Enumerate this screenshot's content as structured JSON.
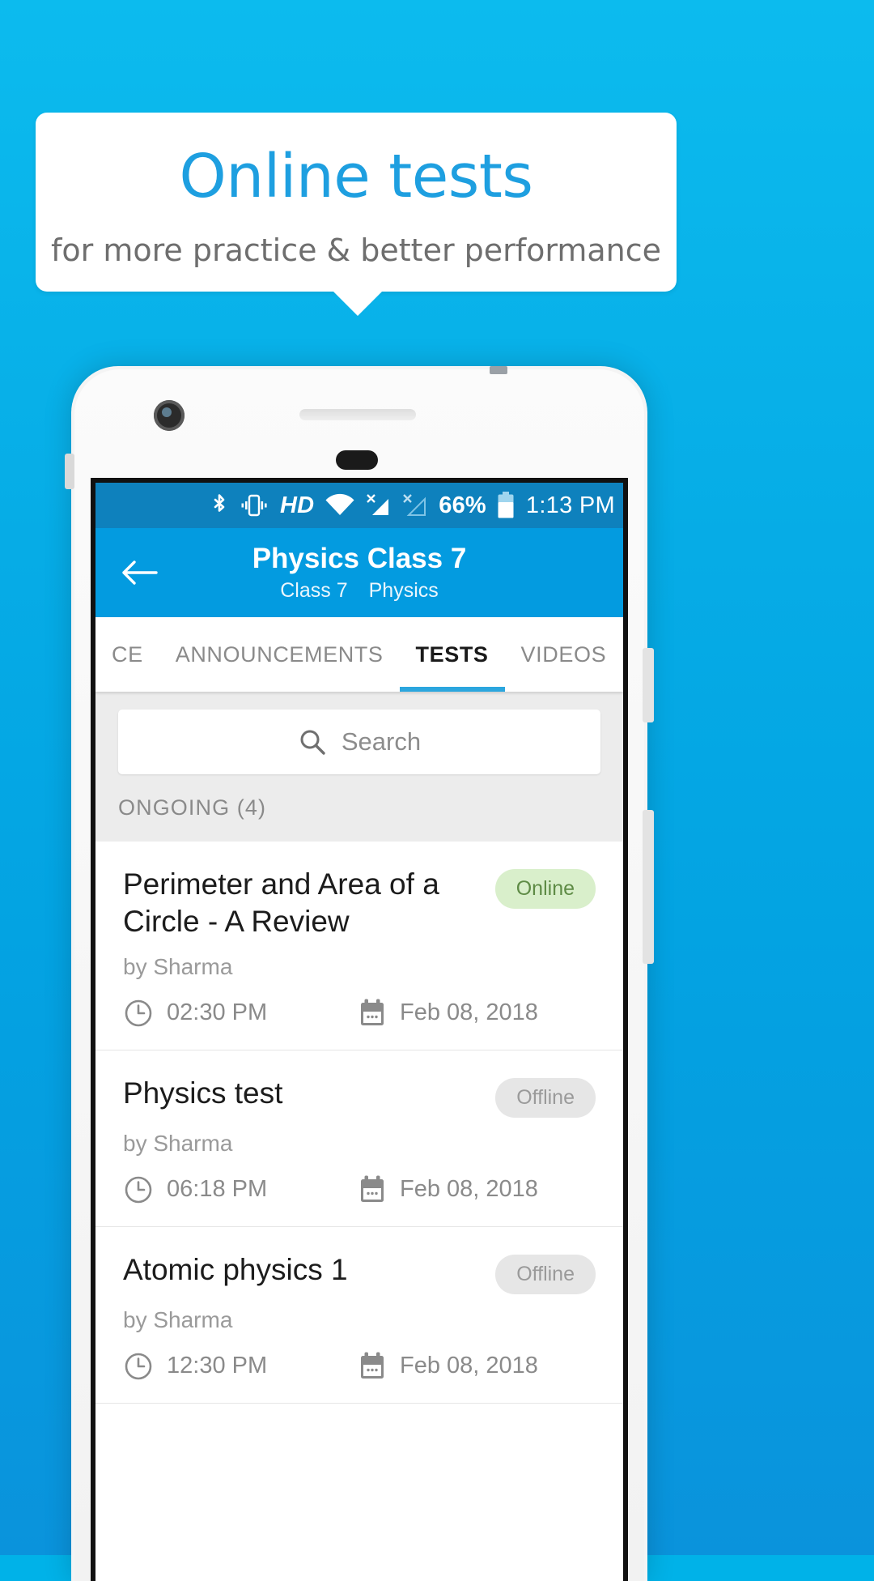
{
  "promo": {
    "title": "Online tests",
    "subtitle": "for more practice & better performance",
    "title_color": "#1E9FE0",
    "subtitle_color": "#6E6E6E",
    "background_color": "#06ACE6"
  },
  "statusbar": {
    "icons": [
      "bluetooth-icon",
      "vibrate-icon",
      "hd-icon",
      "wifi-icon",
      "signal-no-service-icon",
      "signal-no-service-secondary-icon",
      "battery-icon"
    ],
    "hd_label": "HD",
    "battery_percent": "66%",
    "time": "1:13 PM",
    "background_color": "#0E81BD"
  },
  "appbar": {
    "back_icon": "arrow-left-icon",
    "title": "Physics Class 7",
    "subtitle_class": "Class 7",
    "subtitle_subject": "Physics",
    "background_color": "#039BE0"
  },
  "tabs": [
    {
      "label": "CE",
      "active": false
    },
    {
      "label": "ANNOUNCEMENTS",
      "active": false
    },
    {
      "label": "TESTS",
      "active": true
    },
    {
      "label": "VIDEOS",
      "active": false
    }
  ],
  "tab_indicator_color": "#2BA6DE",
  "search": {
    "placeholder": "Search",
    "icon": "search-icon"
  },
  "section": {
    "label": "ONGOING (4)"
  },
  "tests": [
    {
      "title": "Perimeter and Area of a Circle - A Review",
      "status": "Online",
      "status_type": "online",
      "author": "by Sharma",
      "time": "02:30 PM",
      "date": "Feb 08, 2018"
    },
    {
      "title": "Physics test",
      "status": "Offline",
      "status_type": "offline",
      "author": "by Sharma",
      "time": "06:18 PM",
      "date": "Feb 08, 2018"
    },
    {
      "title": "Atomic physics 1",
      "status": "Offline",
      "status_type": "offline",
      "author": "by Sharma",
      "time": "12:30 PM",
      "date": "Feb 08, 2018"
    }
  ],
  "colors": {
    "online_badge_bg": "#D9EFCB",
    "online_badge_text": "#5E8B45",
    "offline_badge_bg": "#E6E6E6",
    "offline_badge_text": "#9A9A9A"
  }
}
